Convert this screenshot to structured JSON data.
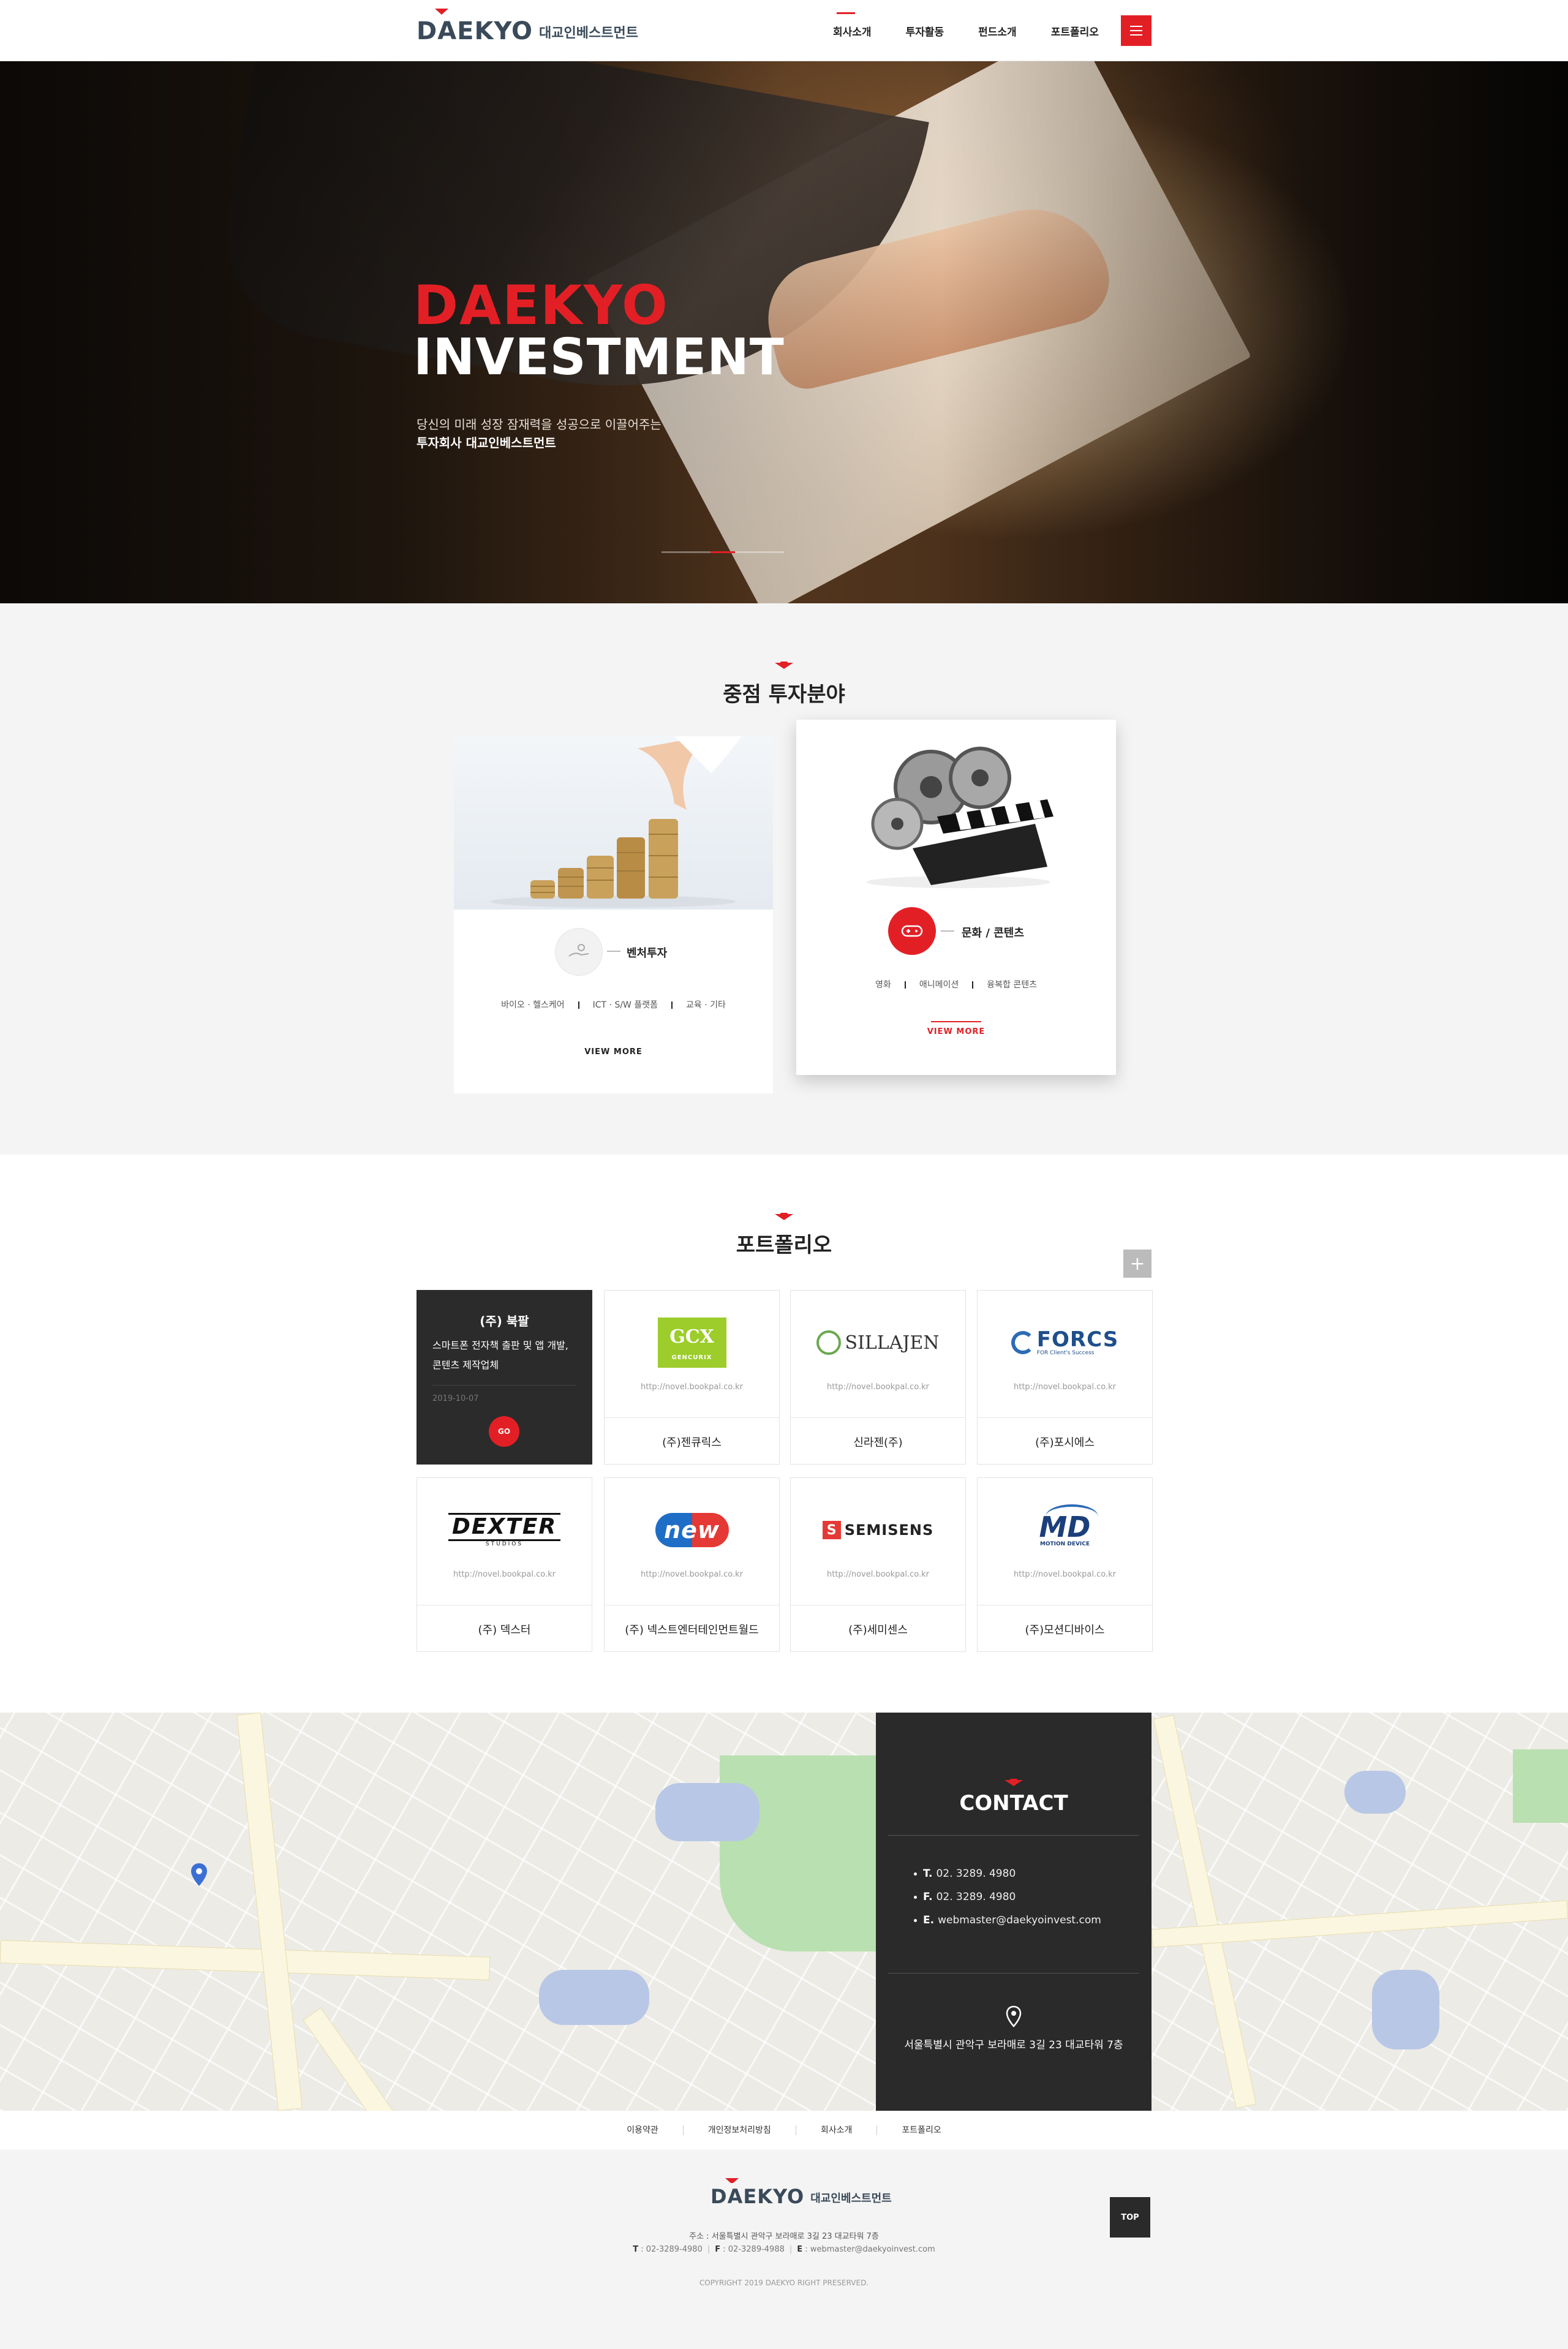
{
  "header": {
    "logo_text": "DAEKYO",
    "logo_sub": "대교인베스트먼트",
    "nav": [
      "회사소개",
      "투자활동",
      "펀드소개",
      "포트폴리오"
    ]
  },
  "hero": {
    "title1": "DAEKYO",
    "title2": "INVESTMENT",
    "desc1": "당신의 미래 성장 잠재력을 성공으로 이끌어주는",
    "desc2": "투자회사 대교인베스트먼트",
    "slide_count": 5,
    "active_slide": 2
  },
  "focus": {
    "title": "중점 투자분야",
    "cards": [
      {
        "title": "벤처투자",
        "tags": [
          "바이오 · 헬스케어",
          "ICT · S/W 플랫폼",
          "교육 · 기타"
        ],
        "more": "VIEW MORE",
        "icon": "hand-coin-icon"
      },
      {
        "title": "문화 / 콘텐츠",
        "tags": [
          "영화",
          "애니메이션",
          "융복합 콘텐츠"
        ],
        "more": "VIEW MORE",
        "icon": "gamepad-icon"
      }
    ]
  },
  "portfolio": {
    "title": "포트폴리오",
    "plus": "+",
    "featured": {
      "name": "(주) 북팔",
      "desc": "스마트폰 전자책 출판 및 앱 개발, 콘텐츠 제작업체",
      "date": "2019-10-07",
      "go": "GO"
    },
    "items": [
      {
        "name": "(주)젠큐릭스",
        "url": "http://novel.bookpal.co.kr",
        "logo": "GCX",
        "logo_sub": "GENCURIX"
      },
      {
        "name": "신라젠(주)",
        "url": "http://novel.bookpal.co.kr",
        "logo": "SILLAJEN"
      },
      {
        "name": "(주)포시에스",
        "url": "http://novel.bookpal.co.kr",
        "logo": "FORCS",
        "logo_sub": "FOR Client's Success"
      },
      {
        "name": "(주) 덱스터",
        "url": "http://novel.bookpal.co.kr",
        "logo": "DEXTER",
        "logo_sub": "STUDIOS"
      },
      {
        "name": "(주) 넥스트엔터테인먼트월드",
        "url": "http://novel.bookpal.co.kr",
        "logo": "NEW"
      },
      {
        "name": "(주)세미센스",
        "url": "http://novel.bookpal.co.kr",
        "logo": "SEMISENS"
      },
      {
        "name": "(주)모션디바이스",
        "url": "http://novel.bookpal.co.kr",
        "logo": "MD",
        "logo_sub": "MOTION DEVICE"
      }
    ]
  },
  "contact": {
    "title": "CONTACT",
    "tel_label": "T.",
    "tel": "02. 3289. 4980",
    "fax_label": "F.",
    "fax": "02. 3289. 4980",
    "email_label": "E.",
    "email": "webmaster@daekyoinvest.com",
    "address": "서울특별시 관악구 보라매로 3길 23 대교타워 7층"
  },
  "footer": {
    "links": [
      "이용약관",
      "개인정보처리방침",
      "회사소개",
      "포트폴리오"
    ],
    "logo_text": "DAEKYO",
    "logo_sub": "대교인베스트먼트",
    "address": "주소 : 서울특별시 관악구 보라매로 3길 23 대교타워 7층",
    "tel_label": "T",
    "tel": ": 02-3289-4980",
    "fax_label": "F",
    "fax": ": 02-3289-4988",
    "email_label": "E",
    "email": ": webmaster@daekyoinvest.com",
    "copyright": "COPYRIGHT 2019 DAEKYO RIGHT PRESERVED.",
    "top": "TOP"
  },
  "colors": {
    "accent": "#e31f26",
    "dark": "#2a2a2a",
    "logo": "#3a4a5a"
  }
}
